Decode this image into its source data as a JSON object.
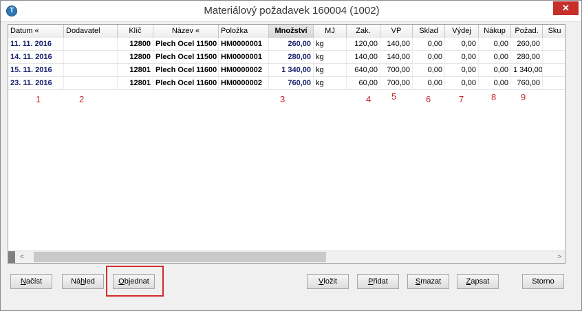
{
  "window": {
    "title": "Materiálový požadavek 160004 (1002)",
    "close_glyph": "✕",
    "app_icon_letter": "T"
  },
  "grid": {
    "columns": [
      "Datum «",
      "Dodavatel",
      "Klíč",
      "Název «",
      "Položka",
      "Množství",
      "MJ",
      "Zak.",
      "VP",
      "Sklad",
      "Výdej",
      "Nákup",
      "Požad.",
      "Sku"
    ],
    "rows": [
      [
        "11. 11. 2016",
        "",
        "12800",
        "Plech Ocel 11500",
        "HM0000001",
        "260,00",
        "kg",
        "120,00",
        "140,00",
        "0,00",
        "0,00",
        "0,00",
        "260,00"
      ],
      [
        "14. 11. 2016",
        "",
        "12800",
        "Plech Ocel 11500",
        "HM0000001",
        "280,00",
        "kg",
        "140,00",
        "140,00",
        "0,00",
        "0,00",
        "0,00",
        "280,00"
      ],
      [
        "15. 11. 2016",
        "",
        "12801",
        "Plech Ocel 11600",
        "HM0000002",
        "1 340,00",
        "kg",
        "640,00",
        "700,00",
        "0,00",
        "0,00",
        "0,00",
        "1 340,00"
      ],
      [
        "23. 11. 2016",
        "",
        "12801",
        "Plech Ocel 11600",
        "HM0000002",
        "760,00",
        "kg",
        "60,00",
        "700,00",
        "0,00",
        "0,00",
        "0,00",
        "760,00"
      ]
    ]
  },
  "annotations": [
    "1",
    "2",
    "3",
    "4",
    "5",
    "6",
    "7",
    "8",
    "9"
  ],
  "scrollbar": {
    "left_arrow": "<",
    "right_arrow": ">"
  },
  "buttons": {
    "nacist": {
      "key": "N",
      "rest": "ačíst"
    },
    "nahled": {
      "pre": "Ná",
      "key": "h",
      "rest": "led"
    },
    "objednat": {
      "key": "O",
      "rest": "bjednat"
    },
    "vlozit": {
      "key": "V",
      "rest": "ložit"
    },
    "pridat": {
      "key": "P",
      "rest": "řidat"
    },
    "smazat": {
      "key": "S",
      "rest": "mazat"
    },
    "zapsat": {
      "key": "Z",
      "rest": "apsat"
    },
    "storno": {
      "label": "Storno"
    }
  }
}
